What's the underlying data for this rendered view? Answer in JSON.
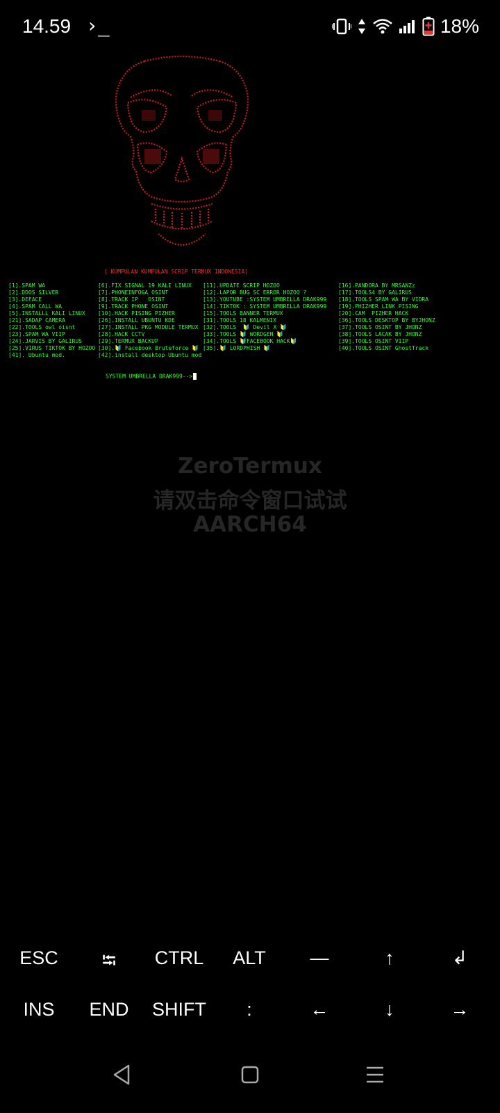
{
  "statusbar": {
    "time": "14.59",
    "terminal_icon": "terminal-prompt-icon",
    "battery": "18%",
    "icons": [
      "vibrate-icon",
      "data-arrows-icon",
      "wifi-icon",
      "signal-icon",
      "battery-charging-icon"
    ]
  },
  "terminal": {
    "banner": "[ KUMPULAN KUMPULAN SCRIP TERMUX INDONESIA]",
    "col1": [
      "[1].SPAM WA",
      "[2].DDOS SILVER",
      "[3].DEFACE",
      "[4].SPAM CALL WA",
      "[5].INSTALLL KALI LINUX",
      "[21].SADAP CAMERA",
      "[22].TOOLS owl oisnt",
      "[23].SPAM WA VIIP",
      "[24].JARVIS BY GALIRUS",
      "[25].VIRUS TIKTOK BY HOZOO",
      "[41]. Ubuntu mod."
    ],
    "col2": [
      "[6].FIX SIGNAL 19 KALI LINUX",
      "[7].PHONEINFOGA OSINT",
      "[8].TRACK IP   OSINT",
      "[9].TRACK PHONE OSINT",
      "[10].HACK PISING PIZHER",
      "[26].INSTALL UBUNTU KDE",
      "[27].INSTALL PKG MODULE TERMUX",
      "[28].HACK CCTV",
      "[29].TERMUX BACKUP",
      "[30].🔰 Facebook Bruteforce 🔰",
      "[42].install desktop Ubuntu mod"
    ],
    "col3": [
      "[11].UPDATE SCRIP HOZOO",
      "[12].LAPOR BUG SC ERROR HOZOO ?",
      "[13].YOUTUBE :SYSTEM UMBRELLA DRAK999",
      "[14].TIKTOK : SYSTEM UMBRELLA DRAK999",
      "[15].TOOLS BANNER TERMUX",
      "[31].TOOLS 18 KALMENIX",
      "[32].TOOLS  🔰 Devil X 🔰",
      "[33].TOOLS 🔰 WORDGEN 🔰",
      "[34].TOOLS 🔰FACEBOOK HACK🔰",
      "[35].🔰 LORDPHISH 🔰"
    ],
    "col4": [
      "[16].PANDORA BY MRSANZz",
      "[17].TOOLS4 BY GALIRUS",
      "[18].TOOLS SPAM WA BY VIDRA",
      "[19].PHIZHER LINK PISING",
      "[20].CAM  PIZHER HACK",
      "[36].TOOLS DESKTOP BY BYJHONZ",
      "[37].TOOLS OSINT BY JHONZ",
      "[38].TOOLS LACAK BY JHONZ",
      "[39].TOOLS OSINT VIIP",
      "[40].TOOLS OSINT GhostTrack"
    ],
    "prompt": "SYSTEM UMBRELLA DRAK999-->"
  },
  "watermark": {
    "line1": "ZeroTermux",
    "line2": "请双击命令窗口试试",
    "line3": "AARCH64"
  },
  "extra_keys": {
    "row1": [
      "ESC",
      "⭾",
      "CTRL",
      "ALT",
      "—",
      "↑",
      "↲"
    ],
    "row2": [
      "INS",
      "END",
      "SHIFT",
      ":",
      "←",
      "↓",
      "→"
    ]
  },
  "navbar": {
    "icons": [
      "back-icon",
      "home-icon",
      "recents-icon"
    ]
  },
  "colors": {
    "menu_text": "#33ff33",
    "banner_text": "#ff2a2a",
    "skull": "#c81e1e"
  }
}
